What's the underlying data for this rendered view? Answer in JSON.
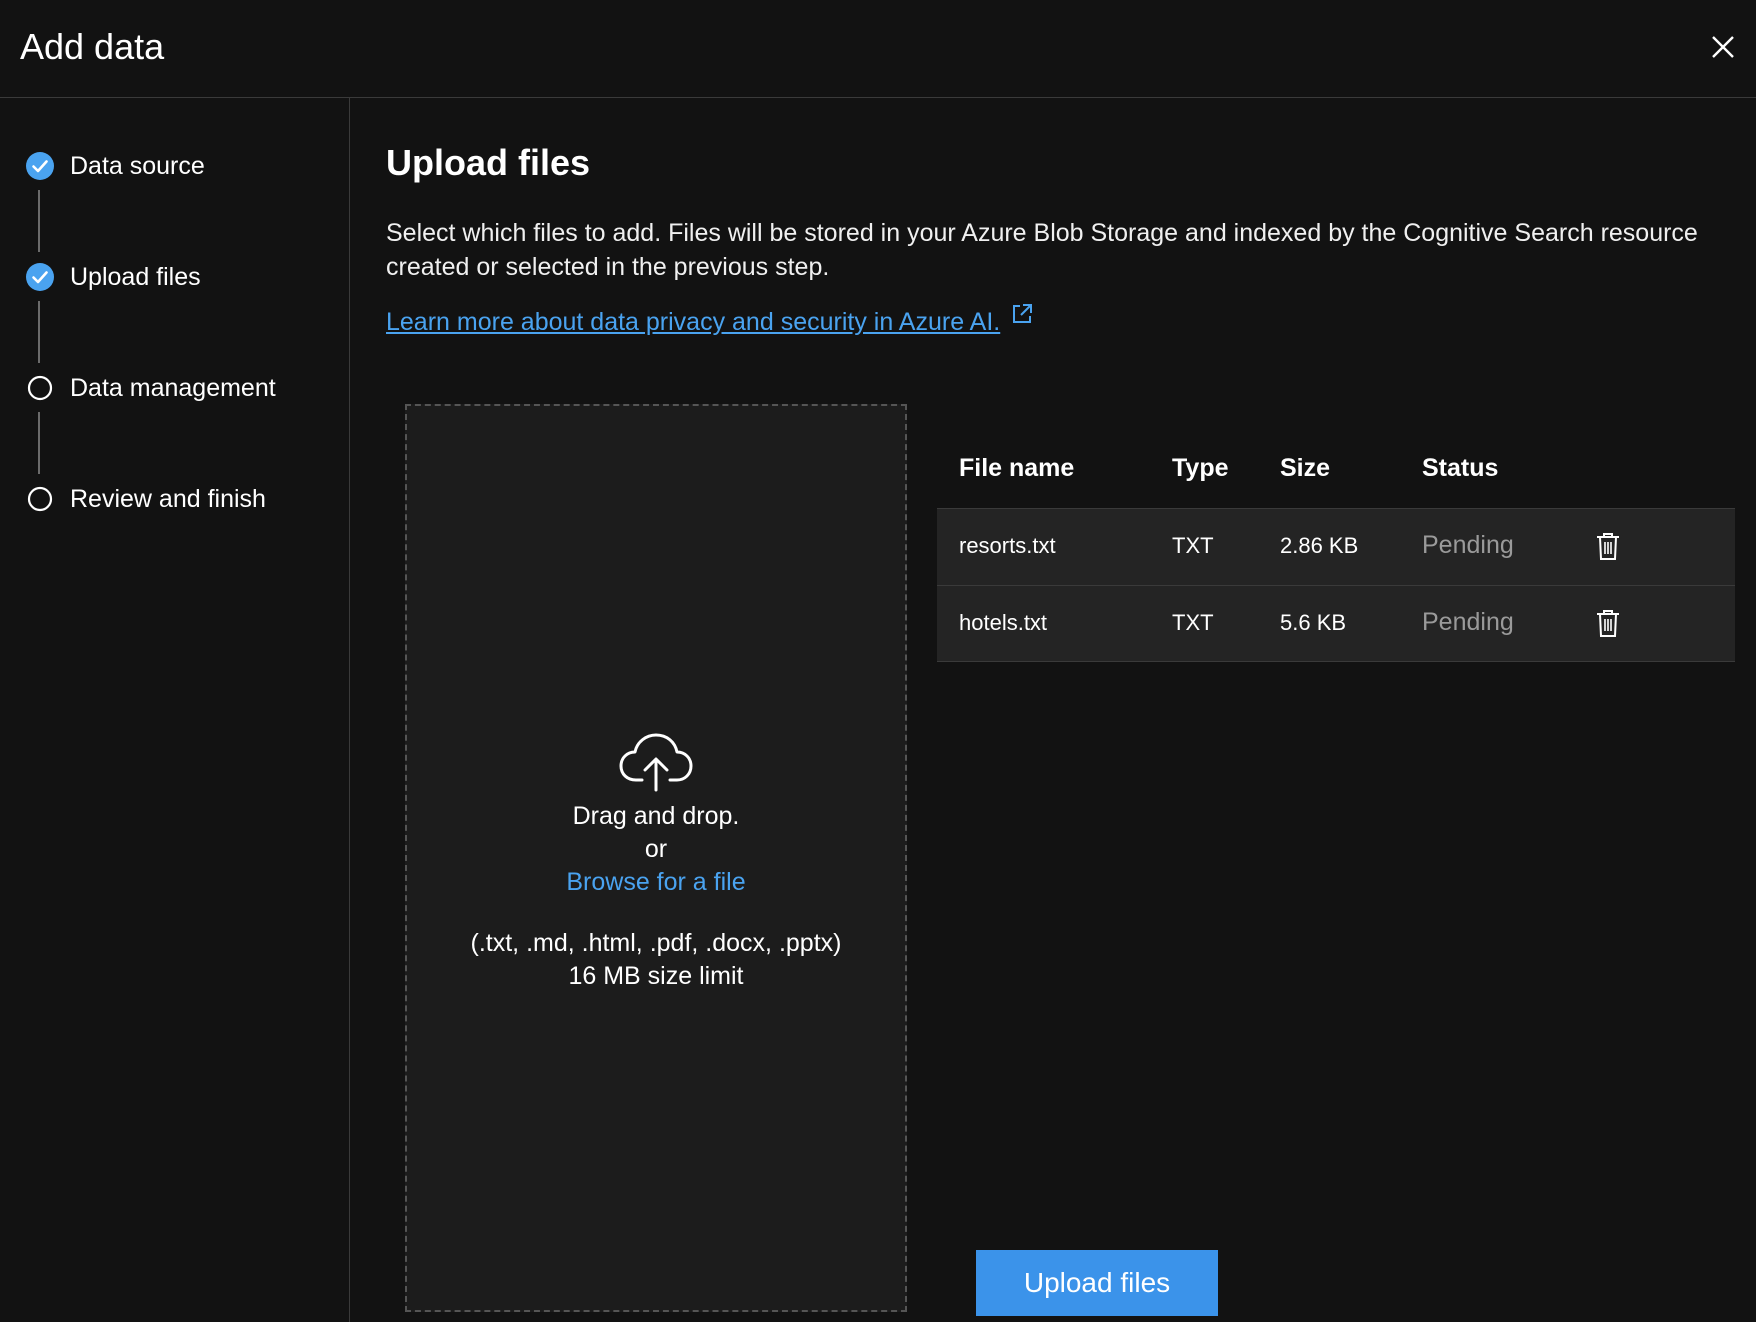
{
  "header": {
    "title": "Add data"
  },
  "steps": [
    {
      "label": "Data source",
      "state": "complete"
    },
    {
      "label": "Upload files",
      "state": "complete"
    },
    {
      "label": "Data management",
      "state": "pending"
    },
    {
      "label": "Review and finish",
      "state": "pending"
    }
  ],
  "main": {
    "title": "Upload files",
    "description": "Select which files to add. Files will be stored in your Azure Blob Storage and indexed by the Cognitive Search resource created or selected in the previous step.",
    "learn_more": "Learn more about data privacy and security in Azure AI."
  },
  "dropzone": {
    "line1": "Drag and drop.",
    "line2": "or",
    "browse": "Browse for a file",
    "formats": "(.txt, .md, .html, .pdf, .docx, .pptx)",
    "limit": "16 MB size limit"
  },
  "table": {
    "headers": {
      "name": "File name",
      "type": "Type",
      "size": "Size",
      "status": "Status"
    },
    "rows": [
      {
        "name": "resorts.txt",
        "type": "TXT",
        "size": "2.86 KB",
        "status": "Pending"
      },
      {
        "name": "hotels.txt",
        "type": "TXT",
        "size": "5.6 KB",
        "status": "Pending"
      }
    ]
  },
  "actions": {
    "upload": "Upload files"
  },
  "colors": {
    "accent": "#3b93ea",
    "link": "#4aa3f0",
    "background": "#121212"
  }
}
